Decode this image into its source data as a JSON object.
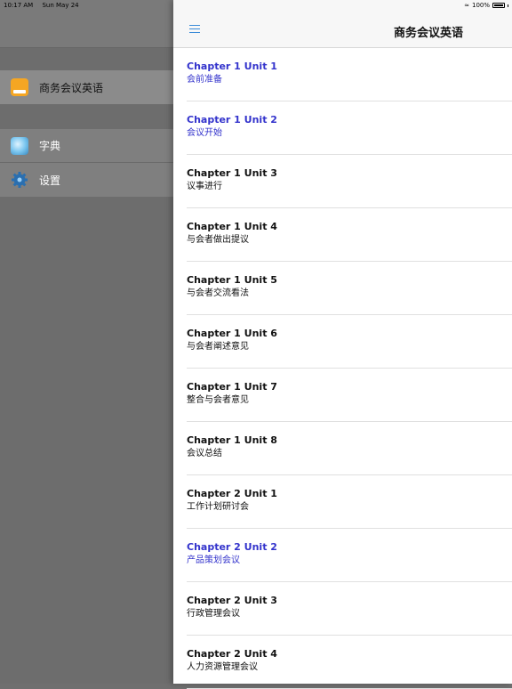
{
  "status": {
    "time": "10:17 AM",
    "date": "Sun May 24",
    "battery": "100%"
  },
  "sidebar": {
    "items": [
      {
        "label": "商务会议英语",
        "icon": "app-icon"
      },
      {
        "label": "字典",
        "icon": "dictionary-icon"
      },
      {
        "label": "设置",
        "icon": "gear-icon"
      }
    ]
  },
  "header": {
    "title": "商务会议英语"
  },
  "list": [
    {
      "title": "Chapter 1 Unit 1",
      "subtitle": "会前准备",
      "highlight": true
    },
    {
      "title": "Chapter 1 Unit 2",
      "subtitle": "会议开始",
      "highlight": true
    },
    {
      "title": "Chapter 1 Unit 3",
      "subtitle": "议事进行",
      "highlight": false
    },
    {
      "title": "Chapter 1 Unit 4",
      "subtitle": "与会者做出提议",
      "highlight": false
    },
    {
      "title": "Chapter 1 Unit 5",
      "subtitle": "与会者交流看法",
      "highlight": false
    },
    {
      "title": "Chapter 1 Unit 6",
      "subtitle": "与会者阐述意见",
      "highlight": false
    },
    {
      "title": "Chapter 1 Unit 7",
      "subtitle": "整合与会者意见",
      "highlight": false
    },
    {
      "title": "Chapter 1 Unit 8",
      "subtitle": "会议总结",
      "highlight": false
    },
    {
      "title": "Chapter 2 Unit 1",
      "subtitle": "工作计划研讨会",
      "highlight": false
    },
    {
      "title": "Chapter 2 Unit 2",
      "subtitle": "产品策划会议",
      "highlight": true
    },
    {
      "title": "Chapter 2 Unit 3",
      "subtitle": "行政管理会议",
      "highlight": false
    },
    {
      "title": "Chapter 2 Unit 4",
      "subtitle": "人力资源管理会议",
      "highlight": false
    }
  ]
}
